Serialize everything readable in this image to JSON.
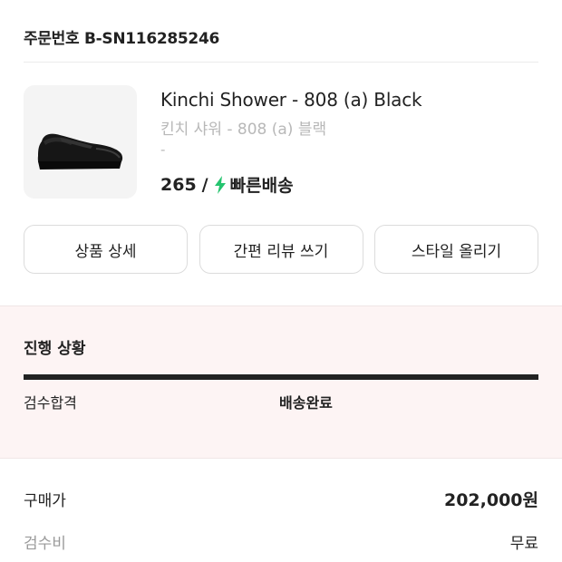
{
  "order": {
    "number_text": "주문번호 B-SN116285246"
  },
  "product": {
    "name_en": "Kinchi Shower - 808 (a) Black",
    "name_ko": "킨치 샤워 - 808 (a) 블랙",
    "option": "-",
    "size": "265",
    "separator": "/",
    "delivery_icon": "lightning-bolt-icon",
    "delivery_label": "빠른배송",
    "delivery_icon_color": "#25c46f"
  },
  "actions": {
    "detail_label": "상품 상세",
    "review_label": "간편 리뷰 쓰기",
    "style_label": "스타일 올리기"
  },
  "progress": {
    "title": "진행 상황",
    "steps": [
      "검수합격",
      "배송완료"
    ],
    "fill_fraction": 1.0,
    "bg_color": "#fdf4f4"
  },
  "pricing": {
    "purchase_label": "구매가",
    "purchase_value": "202,000원",
    "inspection_label": "검수비",
    "inspection_value": "무료"
  }
}
